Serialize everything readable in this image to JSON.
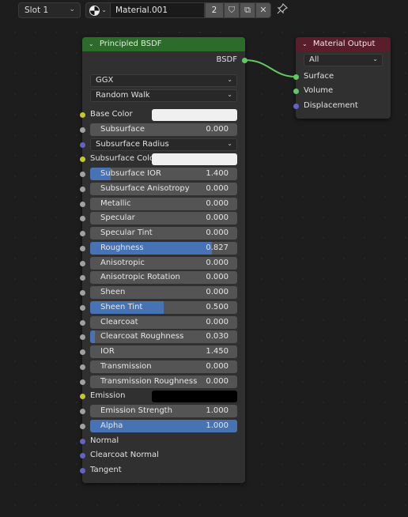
{
  "header": {
    "slot": "Slot 1",
    "material_name": "Material.001",
    "user_count": "2",
    "icons": {
      "material_browse": "material-sphere-icon",
      "fake_user": "shield-icon",
      "duplicate": "duplicate-icon",
      "unlink": "close-icon",
      "pin": "pin-icon"
    },
    "glyphs": {
      "chevron": "⌄",
      "shield": "⛉",
      "duplicate": "⧉",
      "close": "✕",
      "pin": "📌"
    }
  },
  "principled": {
    "title": "Principled BSDF",
    "output": "BSDF",
    "distribution": "GGX",
    "subsurface_method": "Random Walk",
    "inputs": [
      {
        "kind": "color",
        "label": "Base Color",
        "socket": "yellow",
        "color": "#f0f0f0"
      },
      {
        "kind": "slider",
        "label": "Subsurface",
        "value": "0.000",
        "fraction": 0,
        "socket": "gray"
      },
      {
        "kind": "dropdown",
        "label": "Subsurface Radius",
        "socket": "blue"
      },
      {
        "kind": "color",
        "label": "Subsurface Color",
        "socket": "yellow",
        "color": "#f0f0f0"
      },
      {
        "kind": "slider",
        "label": "Subsurface IOR",
        "value": "1.400",
        "fraction": 0.14,
        "socket": "gray"
      },
      {
        "kind": "slider",
        "label": "Subsurface Anisotropy",
        "value": "0.000",
        "fraction": 0,
        "socket": "gray"
      },
      {
        "kind": "slider",
        "label": "Metallic",
        "value": "0.000",
        "fraction": 0,
        "socket": "gray"
      },
      {
        "kind": "slider",
        "label": "Specular",
        "value": "0.000",
        "fraction": 0,
        "socket": "gray"
      },
      {
        "kind": "slider",
        "label": "Specular Tint",
        "value": "0.000",
        "fraction": 0,
        "socket": "gray"
      },
      {
        "kind": "slider",
        "label": "Roughness",
        "value": "0.827",
        "fraction": 0.827,
        "socket": "gray"
      },
      {
        "kind": "slider",
        "label": "Anisotropic",
        "value": "0.000",
        "fraction": 0,
        "socket": "gray"
      },
      {
        "kind": "slider",
        "label": "Anisotropic Rotation",
        "value": "0.000",
        "fraction": 0,
        "socket": "gray"
      },
      {
        "kind": "slider",
        "label": "Sheen",
        "value": "0.000",
        "fraction": 0,
        "socket": "gray"
      },
      {
        "kind": "slider",
        "label": "Sheen Tint",
        "value": "0.500",
        "fraction": 0.5,
        "socket": "gray"
      },
      {
        "kind": "slider",
        "label": "Clearcoat",
        "value": "0.000",
        "fraction": 0,
        "socket": "gray"
      },
      {
        "kind": "slider",
        "label": "Clearcoat Roughness",
        "value": "0.030",
        "fraction": 0.03,
        "socket": "gray"
      },
      {
        "kind": "slider",
        "label": "IOR",
        "value": "1.450",
        "fraction": 0,
        "socket": "gray"
      },
      {
        "kind": "slider",
        "label": "Transmission",
        "value": "0.000",
        "fraction": 0,
        "socket": "gray"
      },
      {
        "kind": "slider",
        "label": "Transmission Roughness",
        "value": "0.000",
        "fraction": 0,
        "socket": "gray"
      },
      {
        "kind": "color",
        "label": "Emission",
        "socket": "yellow",
        "color": "#000000"
      },
      {
        "kind": "slider",
        "label": "Emission Strength",
        "value": "1.000",
        "fraction": 0,
        "socket": "gray"
      },
      {
        "kind": "slider",
        "label": "Alpha",
        "value": "1.000",
        "fraction": 1.0,
        "socket": "gray"
      },
      {
        "kind": "socket",
        "label": "Normal",
        "socket": "blue"
      },
      {
        "kind": "socket",
        "label": "Clearcoat Normal",
        "socket": "blue"
      },
      {
        "kind": "socket",
        "label": "Tangent",
        "socket": "blue"
      }
    ]
  },
  "material_output": {
    "title": "Material Output",
    "target": "All",
    "inputs": [
      {
        "label": "Surface",
        "socket": "green"
      },
      {
        "label": "Volume",
        "socket": "green"
      },
      {
        "label": "Displacement",
        "socket": "blue"
      }
    ]
  },
  "colors": {
    "bsdf_header": "#2d6b2b",
    "output_header": "#5a1e2a",
    "slider_fill": "#4772b3",
    "link": "#63c763"
  }
}
